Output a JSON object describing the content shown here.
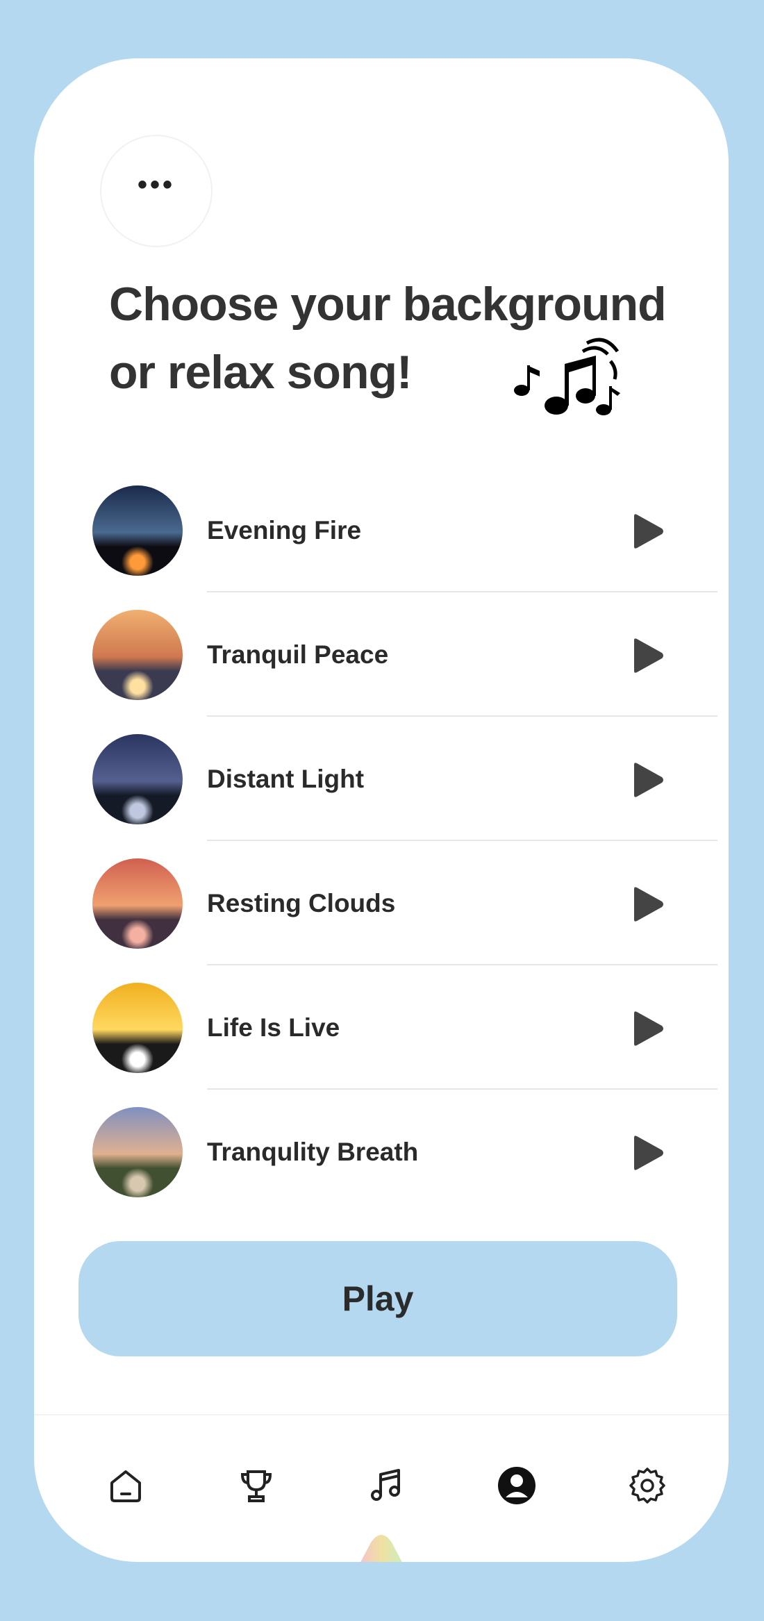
{
  "header": {
    "menu_glyph": "•••",
    "title_line1": "Choose your background",
    "title_line2": "or relax song!"
  },
  "songs": [
    {
      "title": "Evening Fire",
      "colors": [
        "#1a2a4a",
        "#4a6a8f",
        "#0c0c12",
        "#ff9a3a"
      ]
    },
    {
      "title": "Tranquil Peace",
      "colors": [
        "#f0b070",
        "#d07850",
        "#3a3a50",
        "#ffe0a0"
      ]
    },
    {
      "title": "Distant Light",
      "colors": [
        "#2a3560",
        "#556090",
        "#141a26",
        "#c0c8e0"
      ]
    },
    {
      "title": "Resting Clouds",
      "colors": [
        "#d06050",
        "#f0a070",
        "#403040",
        "#f4b0a0"
      ]
    },
    {
      "title": "Life Is Live",
      "colors": [
        "#f0b020",
        "#ffd860",
        "#1a1a1a",
        "#ffffff"
      ]
    },
    {
      "title": "Tranqulity Breath",
      "colors": [
        "#8090c0",
        "#e0b090",
        "#405030",
        "#d8c8b0"
      ]
    }
  ],
  "play_button": {
    "label": "Play"
  },
  "nav": {
    "items": [
      "home-icon",
      "trophy-icon",
      "music-icon",
      "profile-icon",
      "settings-icon"
    ],
    "active": "music-icon"
  },
  "colors": {
    "accent": "#b3d8ef",
    "text": "#333333",
    "play_icon": "#444444"
  }
}
